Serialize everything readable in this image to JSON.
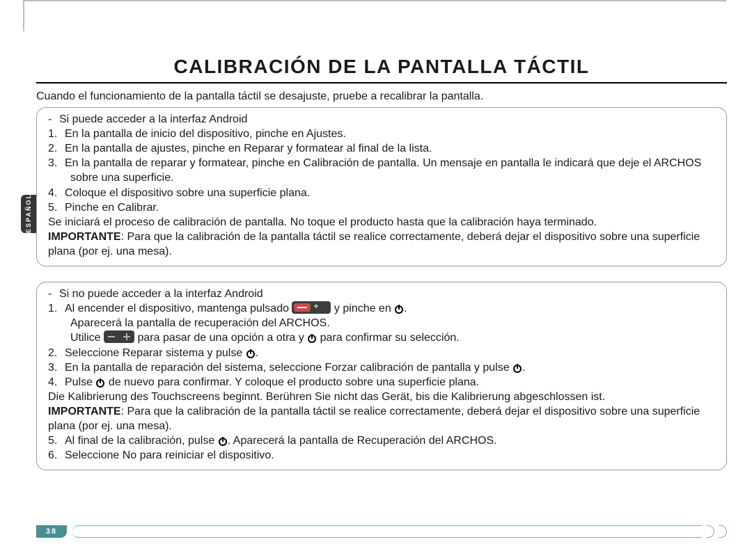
{
  "title": "CALIBRACIÓN DE LA PANTALLA TÁCTIL",
  "lang_tab": "ESPAÑOL",
  "page_num": "38",
  "lead": "Cuando el funcionamiento de la pantalla táctil se desajuste, pruebe a recalibrar la pantalla.",
  "box_a": {
    "heading": "Si puede acceder a la interfaz Android",
    "items": [
      "En la pantalla de inicio del dispositivo, pinche en Ajustes.",
      "En la pantalla de ajustes, pinche en Reparar y formatear al final de la lista.",
      "En la pantalla de reparar y formatear, pinche en Calibración de pantalla. Un mensaje en pantalla le indicará que deje el ARCHOS sobre una superficie.",
      "Coloque el dispositivo sobre una superficie plana.",
      "Pinche en Calibrar."
    ],
    "after1": "Se iniciará el proceso de calibración de pantalla. No toque el producto hasta que la calibración haya terminado.",
    "imp_label": "IMPORTANTE",
    "imp_text": ": Para que la calibración de la pantalla táctil se realice correctamente, deberá dejar el dispositivo sobre una superficie plana (por ej. una mesa)."
  },
  "box_b": {
    "heading": "Si no puede acceder a la interfaz Android",
    "s1a": "Al encender el dispositivo, mantenga pulsado ",
    "s1b": " y pinche en ",
    "s1c": "Aparecerá la pantalla de recuperación del ARCHOS.",
    "s1d1": "Utilice ",
    "s1d2": " para pasar de una opción a otra y ",
    "s1d3": " para confirmar su selección.",
    "s2": "Seleccione Reparar sistema y pulse ",
    "s3": "En la pantalla de reparación del sistema, seleccione Forzar calibración de pantalla y pulse ",
    "s4a": "Pulse ",
    "s4b": " de nuevo para confirmar. Y coloque el producto sobre una superficie plana.",
    "mid": "Die Kalibrierung des Touchscreens beginnt. Berühren Sie nicht das Gerät, bis die Kalibrierung abgeschlossen ist.",
    "imp_label": "IMPORTANTE",
    "imp_text": ": Para que la calibración de la pantalla táctil se realice correctamente, deberá dejar el dispositivo sobre una superficie plana (por ej. una mesa).",
    "s5a": "Al final de la calibración, pulse ",
    "s5b": ". Aparecerá la pantalla de Recuperación del ARCHOS.",
    "s6": "Seleccione No para reiniciar el dispositivo."
  }
}
